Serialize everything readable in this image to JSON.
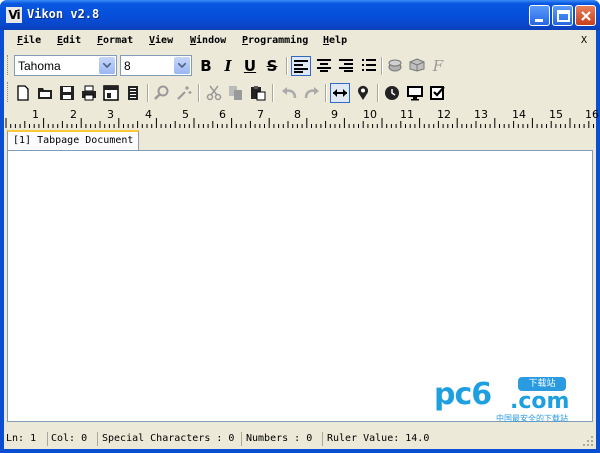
{
  "window": {
    "logo": "Vi",
    "title": "Vikon v2.8"
  },
  "menu": {
    "items": [
      "File",
      "Edit",
      "Format",
      "View",
      "Window",
      "Programming",
      "Help"
    ],
    "close": "X"
  },
  "format_toolbar": {
    "font_name": "Tahoma",
    "font_size": "8",
    "bold_label": "B",
    "italic_label": "I",
    "underline_label": "U",
    "strike_label": "S",
    "font_style_label": "F"
  },
  "ruler": {
    "numbers": [
      "1",
      "2",
      "3",
      "4",
      "5",
      "6",
      "7",
      "8",
      "9",
      "10",
      "11",
      "12",
      "13",
      "14",
      "15",
      "16"
    ]
  },
  "tabs": {
    "active": "[1] Tabpage Document"
  },
  "editor": {
    "content": ""
  },
  "watermark": {
    "brand": "pc6",
    "domain": ".com",
    "badge": "下载站",
    "tagline": "中国最安全的下载站"
  },
  "status": {
    "line": "Ln: 1",
    "col": "Col: 0",
    "special": "Special Characters : 0",
    "numbers": "Numbers : 0",
    "ruler_value": "Ruler Value: 14.0"
  },
  "colors": {
    "titlebar": "#0550dc",
    "chrome": "#ece9d8",
    "tab_accent": "#ffc83c",
    "watermark": "#1ea0e0"
  }
}
